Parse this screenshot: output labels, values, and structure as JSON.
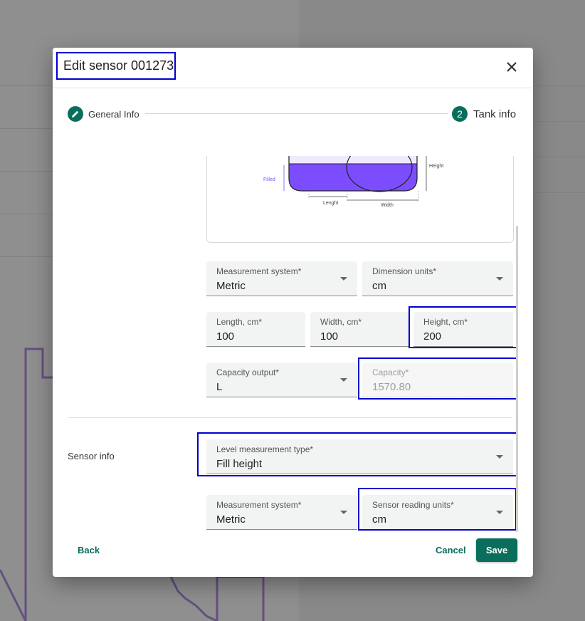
{
  "dialog": {
    "title": "Edit sensor 001273",
    "close_icon": "close-icon"
  },
  "stepper": {
    "steps": [
      {
        "label": "General Info",
        "icon": "pencil-icon",
        "state": "completed"
      },
      {
        "label": "Tank info",
        "number": "2",
        "state": "active"
      }
    ]
  },
  "diagram": {
    "labels": {
      "filled": "Filled",
      "height": "Height",
      "length": "Lenght",
      "width": "Width"
    },
    "fill_color": "#7c4dff"
  },
  "tank_fields": {
    "measurement_system": {
      "label": "Measurement system*",
      "value": "Metric"
    },
    "dimension_units": {
      "label": "Dimension units*",
      "value": "cm"
    },
    "length": {
      "label": "Length, cm*",
      "value": "100"
    },
    "width": {
      "label": "Width, cm*",
      "value": "100"
    },
    "height": {
      "label": "Height, cm*",
      "value": "200"
    },
    "capacity_output": {
      "label": "Capacity output*",
      "value": "L"
    },
    "capacity": {
      "label": "Capacity*",
      "value": "1570.80"
    }
  },
  "sensor_info": {
    "section_label": "Sensor info",
    "level_measurement_type": {
      "label": "Level measurement type*",
      "value": "Fill height"
    },
    "measurement_system": {
      "label": "Measurement system*",
      "value": "Metric"
    },
    "sensor_reading_units": {
      "label": "Sensor reading units*",
      "value": "cm"
    }
  },
  "footer": {
    "back_label": "Back",
    "cancel_label": "Cancel",
    "save_label": "Save"
  },
  "colors": {
    "primary": "#0a6e5c",
    "highlight": "#0000d0"
  }
}
